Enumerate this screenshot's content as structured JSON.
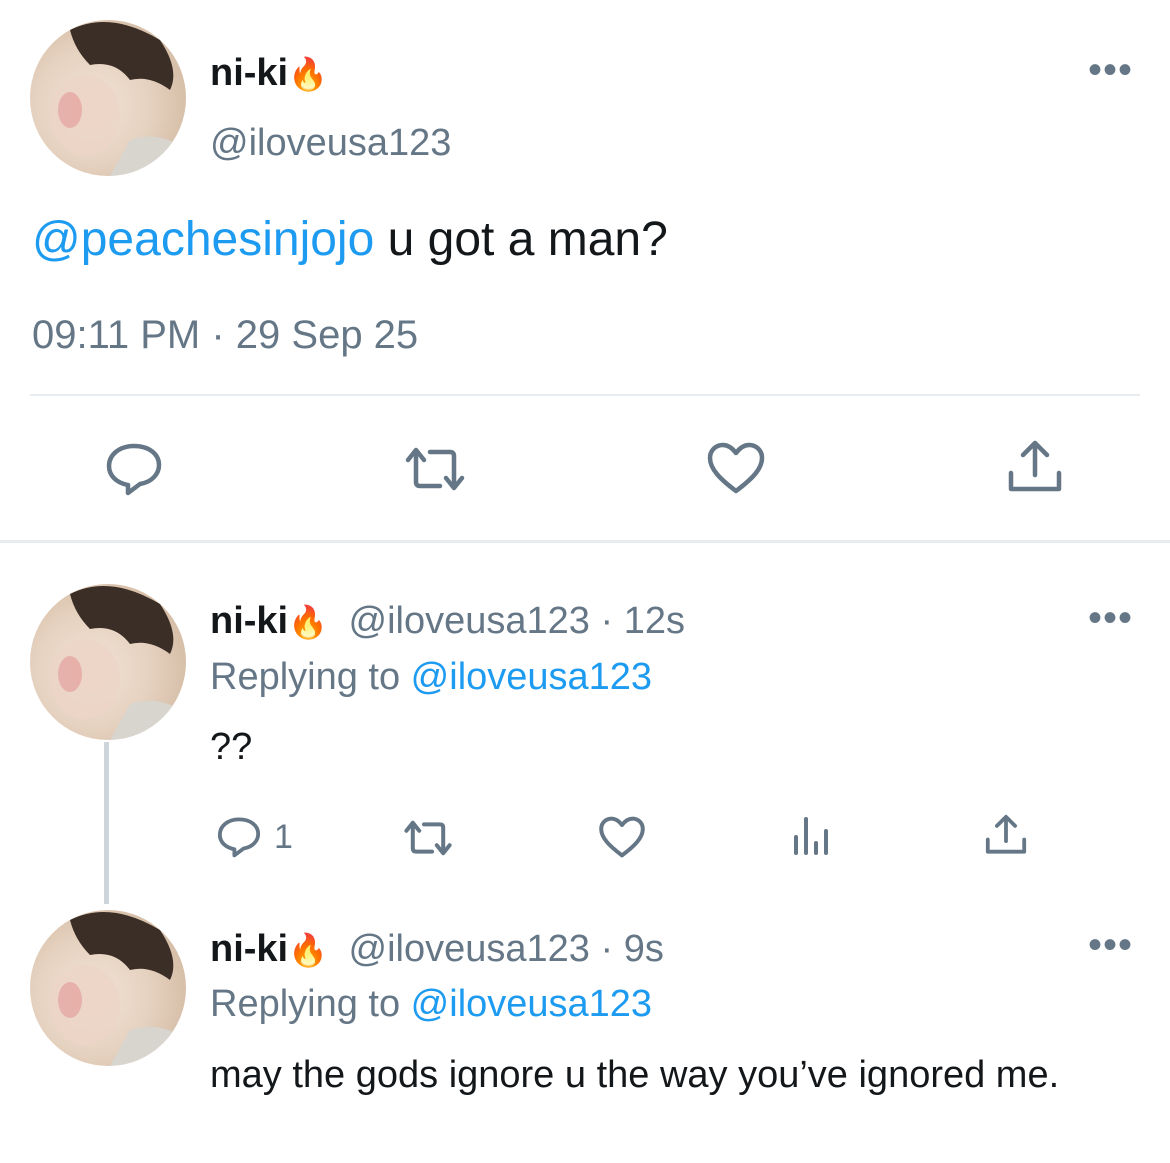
{
  "main_tweet": {
    "display_name": "ni-ki",
    "emoji": "🔥",
    "handle": "@iloveusa123",
    "mention": "@peachesinjojo",
    "text": " u got a man?",
    "timestamp": "09:11 PM · 29 Sep 25",
    "more_glyph": "•••"
  },
  "replies": [
    {
      "display_name": "ni-ki",
      "emoji": "🔥",
      "handle_time": "@iloveusa123 · 12s",
      "replying_prefix": "Replying to ",
      "replying_handle": "@iloveusa123",
      "text": "??",
      "reply_count": "1",
      "more_glyph": "•••"
    },
    {
      "display_name": "ni-ki",
      "emoji": "🔥",
      "handle_time": "@iloveusa123 · 9s",
      "replying_prefix": "Replying to ",
      "replying_handle": "@iloveusa123",
      "text": "may the gods ignore u the way you’ve ignored me.",
      "more_glyph": "•••"
    }
  ],
  "icons": [
    "reply-icon",
    "retweet-icon",
    "like-icon",
    "share-icon",
    "analytics-icon",
    "more-icon"
  ],
  "colors": {
    "accent": "#1d9bf0",
    "muted": "#657786",
    "text": "#14171a"
  }
}
